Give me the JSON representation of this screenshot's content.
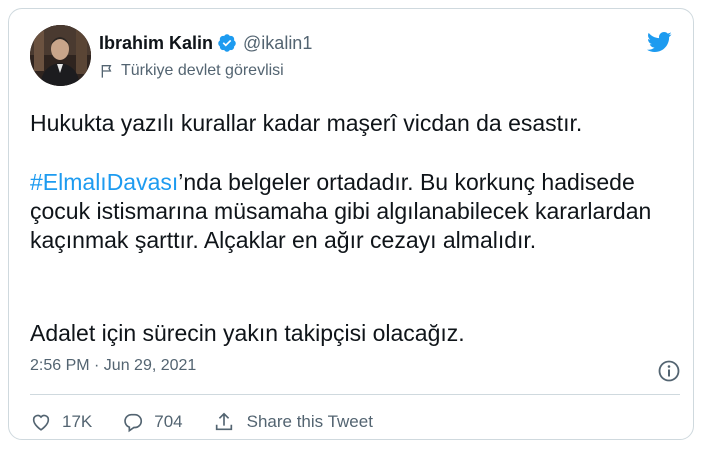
{
  "author": {
    "display_name": "Ibrahim Kalin",
    "handle": "@ikalin1",
    "label": "Türkiye devlet görevlisi",
    "verified": true
  },
  "tweet": {
    "paragraph1": "Hukukta yazılı kurallar kadar maşerî vicdan da esastır.",
    "hashtag": "#ElmalıDavası",
    "paragraph2_rest": "’nda belgeler ortadadır. Bu korkunç hadisede çocuk istismarına müsamaha gibi algılanabilecek kararlardan kaçınmak şarttır. Alçaklar en ağır cezayı almalıdır.",
    "paragraph3": "Adalet için sürecin yakın takipçisi olacağız."
  },
  "meta": {
    "timestamp": "2:56 PM · Jun 29, 2021"
  },
  "actions": {
    "likes": "17K",
    "replies": "704",
    "share_label": "Share this Tweet"
  },
  "colors": {
    "accent": "#1d9bf0",
    "text": "#0f1419",
    "secondary": "#536471",
    "border": "#cfd9de"
  },
  "icons": [
    "avatar-photo",
    "verified-badge-icon",
    "flag-icon",
    "twitter-bird-icon",
    "info-icon",
    "heart-icon",
    "reply-icon",
    "share-icon"
  ]
}
